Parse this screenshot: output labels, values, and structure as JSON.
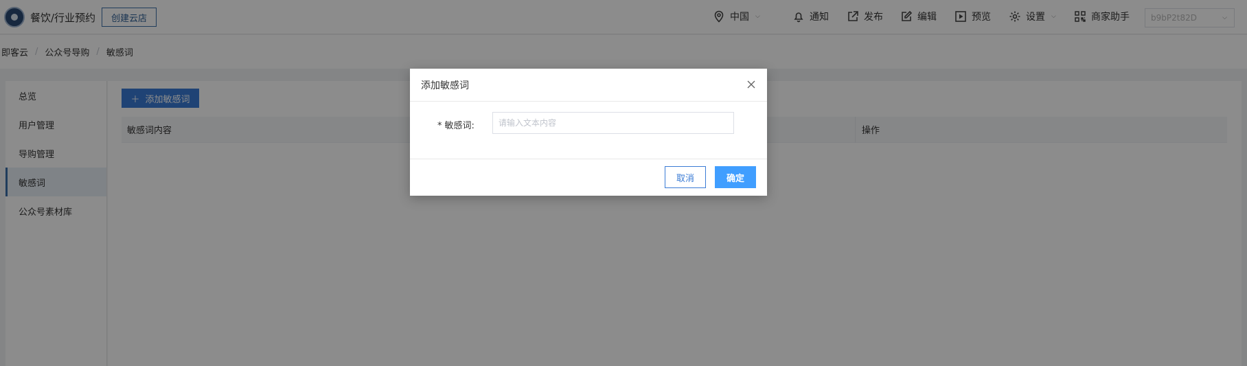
{
  "header": {
    "store_name": "餐饮/行业预约",
    "create_store_label": "创建云店",
    "region_label": "中国",
    "notify_label": "通知",
    "publish_label": "发布",
    "edit_label": "编辑",
    "preview_label": "预览",
    "settings_label": "设置",
    "assistant_label": "商家助手",
    "account_select_value": "b9bP2t82D"
  },
  "breadcrumb": [
    "即客云",
    "公众号导购",
    "敏感词"
  ],
  "sidebar": {
    "items": [
      {
        "label": "总览"
      },
      {
        "label": "用户管理"
      },
      {
        "label": "导购管理"
      },
      {
        "label": "敏感词"
      },
      {
        "label": "公众号素材库"
      }
    ]
  },
  "main": {
    "add_button_label": "添加敏感词",
    "table": {
      "col_content": "敏感词内容",
      "col_operation": "操作"
    }
  },
  "modal": {
    "title": "添加敏感词",
    "field_required_mark": "*",
    "field_label": "敏感词:",
    "field_placeholder": "请输入文本内容",
    "cancel_label": "取消",
    "confirm_label": "确定"
  },
  "colors": {
    "primary": "#409eff",
    "brand": "#3a7bd5",
    "overlay": "#000000"
  }
}
